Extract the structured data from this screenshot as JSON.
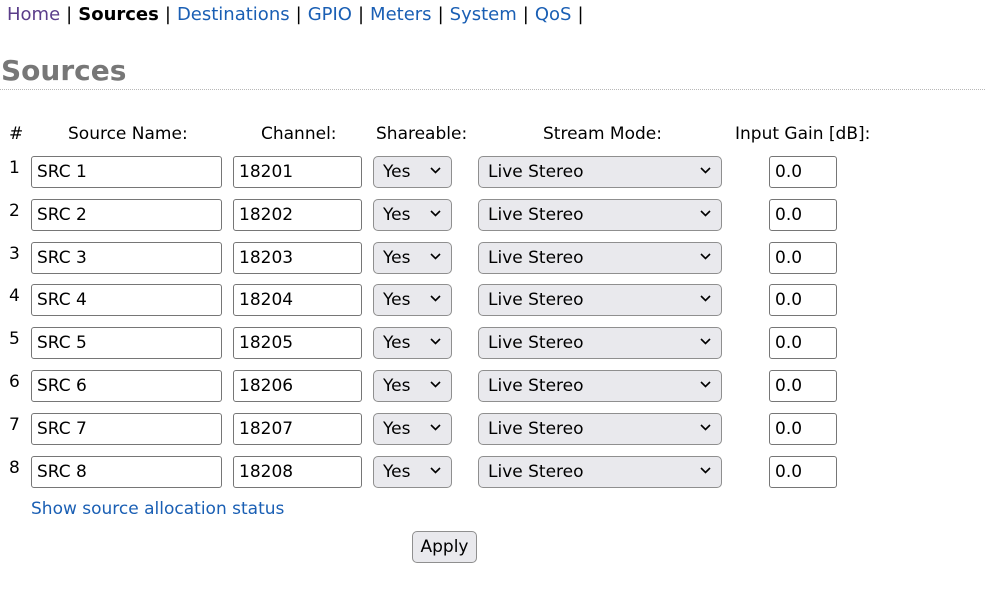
{
  "nav": {
    "items": [
      {
        "label": "Home",
        "state": "visited"
      },
      {
        "label": "Sources",
        "state": "active"
      },
      {
        "label": "Destinations",
        "state": "link"
      },
      {
        "label": "GPIO",
        "state": "link"
      },
      {
        "label": "Meters",
        "state": "link"
      },
      {
        "label": "System",
        "state": "link"
      },
      {
        "label": "QoS",
        "state": "link"
      }
    ],
    "separator": "|"
  },
  "page_title": "Sources",
  "table": {
    "headers": {
      "num": "#",
      "name": "Source Name:",
      "channel": "Channel:",
      "shareable": "Shareable:",
      "stream_mode": "Stream Mode:",
      "gain": "Input Gain [dB]:"
    },
    "rows": [
      {
        "num": "1",
        "name": "SRC 1",
        "channel": "18201",
        "shareable": "Yes",
        "stream_mode": "Live Stereo",
        "gain": "0.0"
      },
      {
        "num": "2",
        "name": "SRC 2",
        "channel": "18202",
        "shareable": "Yes",
        "stream_mode": "Live Stereo",
        "gain": "0.0"
      },
      {
        "num": "3",
        "name": "SRC 3",
        "channel": "18203",
        "shareable": "Yes",
        "stream_mode": "Live Stereo",
        "gain": "0.0"
      },
      {
        "num": "4",
        "name": "SRC 4",
        "channel": "18204",
        "shareable": "Yes",
        "stream_mode": "Live Stereo",
        "gain": "0.0"
      },
      {
        "num": "5",
        "name": "SRC 5",
        "channel": "18205",
        "shareable": "Yes",
        "stream_mode": "Live Stereo",
        "gain": "0.0"
      },
      {
        "num": "6",
        "name": "SRC 6",
        "channel": "18206",
        "shareable": "Yes",
        "stream_mode": "Live Stereo",
        "gain": "0.0"
      },
      {
        "num": "7",
        "name": "SRC 7",
        "channel": "18207",
        "shareable": "Yes",
        "stream_mode": "Live Stereo",
        "gain": "0.0"
      },
      {
        "num": "8",
        "name": "SRC 8",
        "channel": "18208",
        "shareable": "Yes",
        "stream_mode": "Live Stereo",
        "gain": "0.0"
      }
    ]
  },
  "status_link": "Show source allocation status",
  "apply_label": "Apply",
  "colors": {
    "link": "#1a5fb4",
    "visited_link": "#5a3d8a",
    "title": "#777777",
    "control_bg": "#e9e9ed"
  },
  "icons": {
    "select_arrow": "chevron-down-icon"
  }
}
